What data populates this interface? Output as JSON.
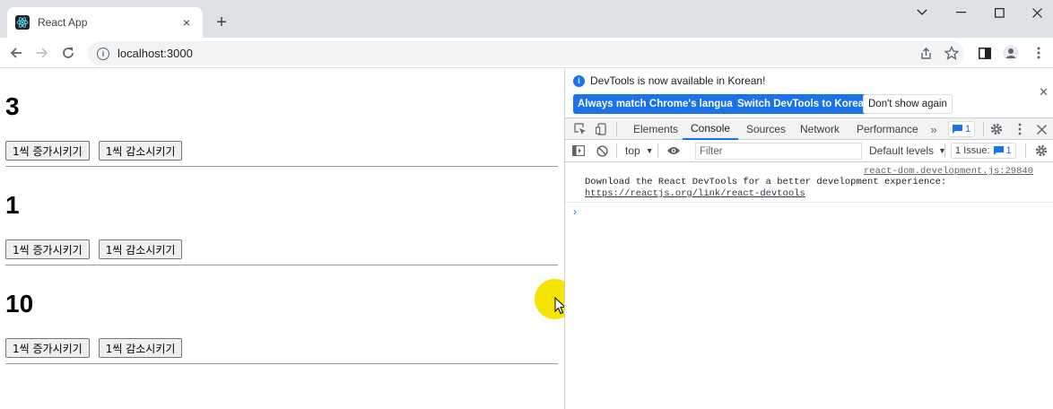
{
  "browser": {
    "tab_title": "React App",
    "tab_close": "×",
    "new_tab": "+",
    "url": "localhost:3000",
    "window_controls": {
      "chevron": "⌄",
      "minimize": "—",
      "maximize": "☐",
      "close": "✕"
    }
  },
  "page": {
    "counters": [
      {
        "value": "3",
        "increase_label": "1씩 증가시키기",
        "decrease_label": "1씩 감소시키기"
      },
      {
        "value": "1",
        "increase_label": "1씩 증가시키기",
        "decrease_label": "1씩 감소시키기"
      },
      {
        "value": "10",
        "increase_label": "1씩 증가시키기",
        "decrease_label": "1씩 감소시키기"
      }
    ]
  },
  "devtools": {
    "infobar": {
      "message": "DevTools is now available in Korean!",
      "btn_match": "Always match Chrome's language",
      "btn_switch": "Switch DevTools to Korean",
      "btn_dismiss": "Don't show again"
    },
    "tabs": [
      "Elements",
      "Console",
      "Sources",
      "Network",
      "Performance"
    ],
    "active_tab": "Console",
    "issues_badge": "1",
    "console_toolbar": {
      "context": "top",
      "filter_placeholder": "Filter",
      "levels": "Default levels",
      "issues": "1 Issue:",
      "issues_count": "1"
    },
    "log": {
      "source": "react-dom.development.js:29840",
      "message": "Download the React DevTools for a better development experience: ",
      "link": "https://reactjs.org/link/react-devtools"
    }
  }
}
